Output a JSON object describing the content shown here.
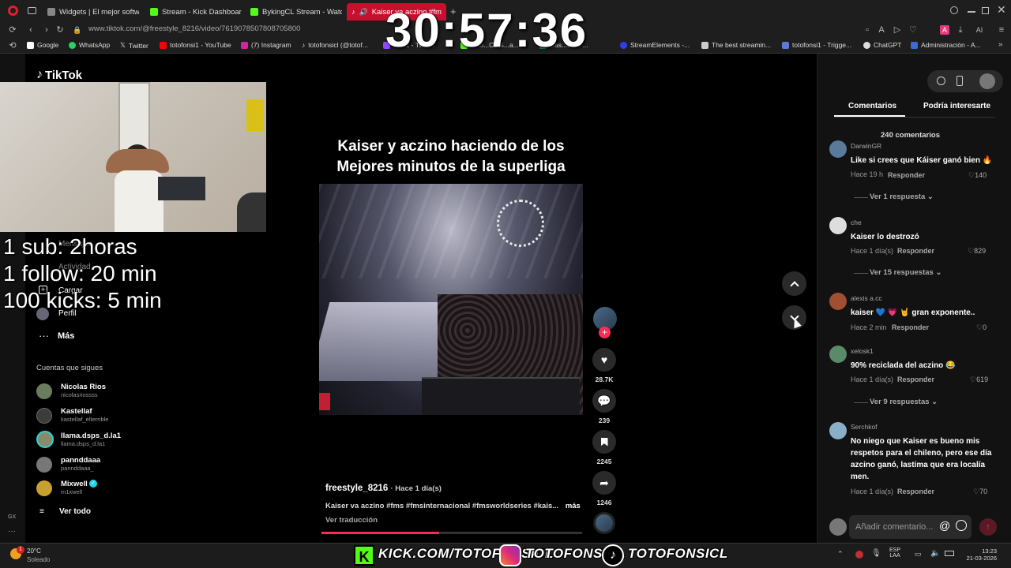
{
  "browser": {
    "tabs": [
      {
        "label": "Widgets | El mejor software",
        "color": "#888888"
      },
      {
        "label": "Stream - Kick Dashboard",
        "color": "#53fc18"
      },
      {
        "label": "BykingCL Stream - Watch",
        "color": "#53fc18"
      },
      {
        "label": "Kaiser va aczino #fm",
        "color": "#ffffff"
      }
    ],
    "url": "www.tiktok.com/@freestyle_8216/video/7619078507808705800",
    "bookmarks": [
      {
        "label": "Google"
      },
      {
        "label": "WhatsApp"
      },
      {
        "label": "Twitter"
      },
      {
        "label": "totofonsi1 - YouTube"
      },
      {
        "label": "(7) Instagram"
      },
      {
        "label": "totofonsicl (@totof..."
      },
      {
        "label": "onsi1 - Twitch"
      },
      {
        "label": "Toto...CL S...a..."
      },
      {
        "label": "Das...ard / ..."
      },
      {
        "label": "StreamElements -..."
      },
      {
        "label": "The best streamin..."
      },
      {
        "label": "totofonsi1 - Trigge..."
      },
      {
        "label": "ChatGPT"
      },
      {
        "label": "Administración - A..."
      }
    ]
  },
  "timer": "30:57:36",
  "tiktok": {
    "logo": "TikTok",
    "nav": {
      "profile": "Perfil",
      "more": "Más",
      "upload": "Cargar",
      "activity": "Actividad",
      "messages": "Mensajes"
    },
    "following_header": "Cuentas que sigues",
    "following": [
      {
        "name": "Nicolas Rios",
        "handle": "nicolasriossss",
        "color": "#6a7c5e"
      },
      {
        "name": "Kastellaf",
        "handle": "kastellaf_elterrible",
        "color": "#3c3c3c"
      },
      {
        "name": "llama.dsps_d.la1",
        "handle": "llama.dsps_d.la1",
        "color": "#8a8a6a"
      },
      {
        "name": "pannddaaa",
        "handle": "pannddaaa_",
        "color": "#777777"
      },
      {
        "name": "Mixwell",
        "handle": "m1xwell",
        "color": "#c8a030",
        "verified": true
      }
    ],
    "see_all": "Ver todo"
  },
  "overlay": {
    "lines": [
      "1 sub: 2horas",
      "1 follow: 20 min",
      "100 kicks: 5 min"
    ]
  },
  "video": {
    "title_line1": "Kaiser y aczino haciendo de los",
    "title_line2": "Mejores minutos de la superliga",
    "author": "freestyle_8216",
    "time": "· Hace 1 día(s)",
    "description": "Kaiser va aczino #fms #fmsinternacional #fmsworldseries #kais...",
    "more": "más",
    "translate": "Ver traducción",
    "likes": "28.7K",
    "comments": "239",
    "saves": "2245",
    "shares": "1246"
  },
  "comments_panel": {
    "tab_comments": "Comentarios",
    "tab_interest": "Podría interesarte",
    "count": "240 comentarios",
    "reply_label": "Responder",
    "input_placeholder": "Añadir comentario...",
    "items": [
      {
        "user": "DarwinGR",
        "text": "Like si crees que Káiser ganó bien 🔥",
        "time": "Hace 19 h",
        "likes": "140",
        "replies": "Ver 1 respuesta",
        "color": "#5a7a9a"
      },
      {
        "user": "che",
        "text": "Kaiser lo destrozó",
        "time": "Hace 1 día(s)",
        "likes": "829",
        "replies": "Ver 15 respuestas",
        "color": "#dddddd"
      },
      {
        "user": "alexis a.cc",
        "text": "kaiser 💙 💗 🤘 gran exponente..",
        "time": "Hace 2 min",
        "likes": "0",
        "replies": "",
        "color": "#a05030"
      },
      {
        "user": "xelosk1",
        "text": "90% reciclada del aczino 😂",
        "time": "Hace 1 día(s)",
        "likes": "619",
        "replies": "Ver 9 respuestas",
        "color": "#5a8a6a"
      },
      {
        "user": "Serchkof",
        "text": "No niego que Kaiser es bueno mis respetos para el chileno, pero ese día azcino ganó, lastima que era localía men.",
        "time": "Hace 1 día(s)",
        "likes": "70",
        "replies": "",
        "color": "#8ab0c8"
      }
    ]
  },
  "taskbar": {
    "weather_temp": "20°C",
    "weather_desc": "Soleado",
    "kick": "KICK.COM/TOTOFONSICL",
    "instagram": "TOTOFONSICL",
    "tiktok": "TOTOFONSICL",
    "lang1": "ESP",
    "lang2": "LAA",
    "time": "13:23",
    "date": "21-03-2026",
    "notif_badge": "1"
  },
  "left_misc": {
    "gx": "GX"
  }
}
